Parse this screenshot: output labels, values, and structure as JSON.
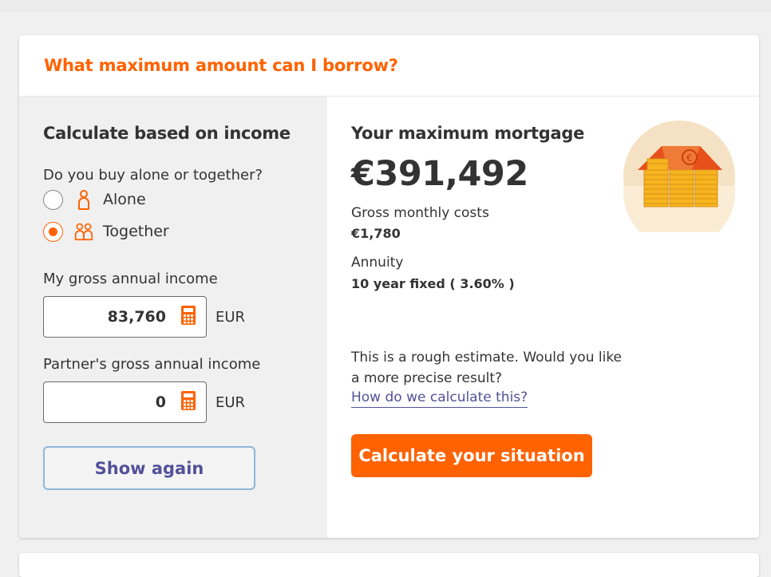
{
  "card": {
    "title": "What maximum amount can I borrow?"
  },
  "income_panel": {
    "heading": "Calculate based on income",
    "question": "Do you buy alone or together?",
    "options": [
      {
        "label": "Alone",
        "icon": "single-person-icon",
        "selected": false
      },
      {
        "label": "Together",
        "icon": "two-persons-icon",
        "selected": true
      }
    ],
    "my_income": {
      "label": "My gross annual income",
      "value": "83,760",
      "currency": "EUR"
    },
    "partner_income": {
      "label": "Partner's gross annual income",
      "value": "0",
      "currency": "EUR"
    },
    "show_again_label": "Show again"
  },
  "result_panel": {
    "heading": "Your maximum mortgage",
    "amount": "€391,492",
    "monthly_label": "Gross monthly costs",
    "monthly_value": "€1,780",
    "loan_type_label": "Annuity",
    "loan_type_value": "10 year fixed ( 3.60% )",
    "note": "This is a rough estimate. Would you like a more precise result?",
    "link_label": "How do we calculate this?",
    "cta_label": "Calculate your situation",
    "illustration": "house-of-coins-illustration"
  },
  "colors": {
    "accent": "#ff6200",
    "link": "#525199",
    "panel_bg": "#f0f0f0"
  }
}
